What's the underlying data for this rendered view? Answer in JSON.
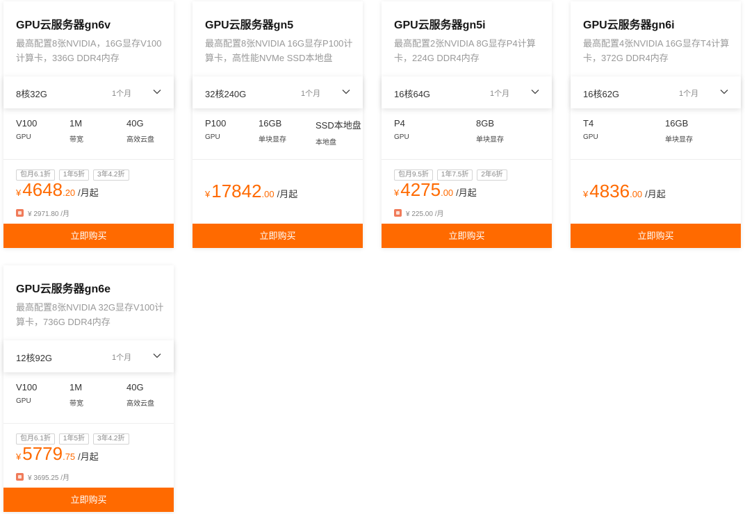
{
  "colors": {
    "accent": "#ff6a00",
    "text_muted": "#999999",
    "badge_border": "#d4d4d4"
  },
  "cards": [
    {
      "title": "GPU云服务器gn6v",
      "desc": "最高配置8张NVIDIA，16G显存V100计算卡，336G DDR4内存",
      "config": "8核32G",
      "period": "1个月",
      "specs": [
        {
          "value": "V100",
          "label": "GPU"
        },
        {
          "value": "1M",
          "label": "带宽"
        },
        {
          "value": "40G",
          "label": "高效云盘"
        }
      ],
      "badges": [
        "包月6.1折",
        "1年5折",
        "3年4.2折"
      ],
      "price": {
        "symbol": "¥",
        "int": "4648",
        "dec": ".20",
        "unit": "/月起"
      },
      "sub_price": "¥ 2971.80 /月",
      "buy_label": "立即购买"
    },
    {
      "title": "GPU云服务器gn5",
      "desc": "最高配置8张NVIDIA 16G显存P100计算卡，高性能NVMe SSD本地盘",
      "config": "32核240G",
      "period": "1个月",
      "specs": [
        {
          "value": "P100",
          "label": "GPU"
        },
        {
          "value": "16GB",
          "label": "单块显存"
        },
        {
          "value": "SSD本地盘",
          "label": "本地盘"
        }
      ],
      "badges": [],
      "price": {
        "symbol": "¥",
        "int": "17842",
        "dec": ".00",
        "unit": "/月起"
      },
      "sub_price": "",
      "buy_label": "立即购买"
    },
    {
      "title": "GPU云服务器gn5i",
      "desc": "最高配置2张NVIDIA 8G显存P4计算卡，224G DDR4内存",
      "config": "16核64G",
      "period": "1个月",
      "specs": [
        {
          "value": "P4",
          "label": "GPU"
        },
        {
          "value": "8GB",
          "label": "单块显存"
        }
      ],
      "badges": [
        "包月9.5折",
        "1年7.5折",
        "2年6折"
      ],
      "price": {
        "symbol": "¥",
        "int": "4275",
        "dec": ".00",
        "unit": "/月起"
      },
      "sub_price": "¥ 225.00 /月",
      "buy_label": "立即购买"
    },
    {
      "title": "GPU云服务器gn6i",
      "desc": "最高配置4张NVIDIA 16G显存T4计算卡，372G DDR4内存",
      "config": "16核62G",
      "period": "1个月",
      "specs": [
        {
          "value": "T4",
          "label": "GPU"
        },
        {
          "value": "16GB",
          "label": "单块显存"
        }
      ],
      "badges": [],
      "price": {
        "symbol": "¥",
        "int": "4836",
        "dec": ".00",
        "unit": "/月起"
      },
      "sub_price": "",
      "buy_label": "立即购买"
    },
    {
      "title": "GPU云服务器gn6e",
      "desc": "最高配置8张NVIDIA 32G显存V100计算卡，736G DDR4内存",
      "config": "12核92G",
      "period": "1个月",
      "specs": [
        {
          "value": "V100",
          "label": "GPU"
        },
        {
          "value": "1M",
          "label": "带宽"
        },
        {
          "value": "40G",
          "label": "高效云盘"
        }
      ],
      "badges": [
        "包月6.1折",
        "1年5折",
        "3年4.2折"
      ],
      "price": {
        "symbol": "¥",
        "int": "5779",
        "dec": ".75",
        "unit": "/月起"
      },
      "sub_price": "¥ 3695.25 /月",
      "buy_label": "立即购买"
    }
  ]
}
